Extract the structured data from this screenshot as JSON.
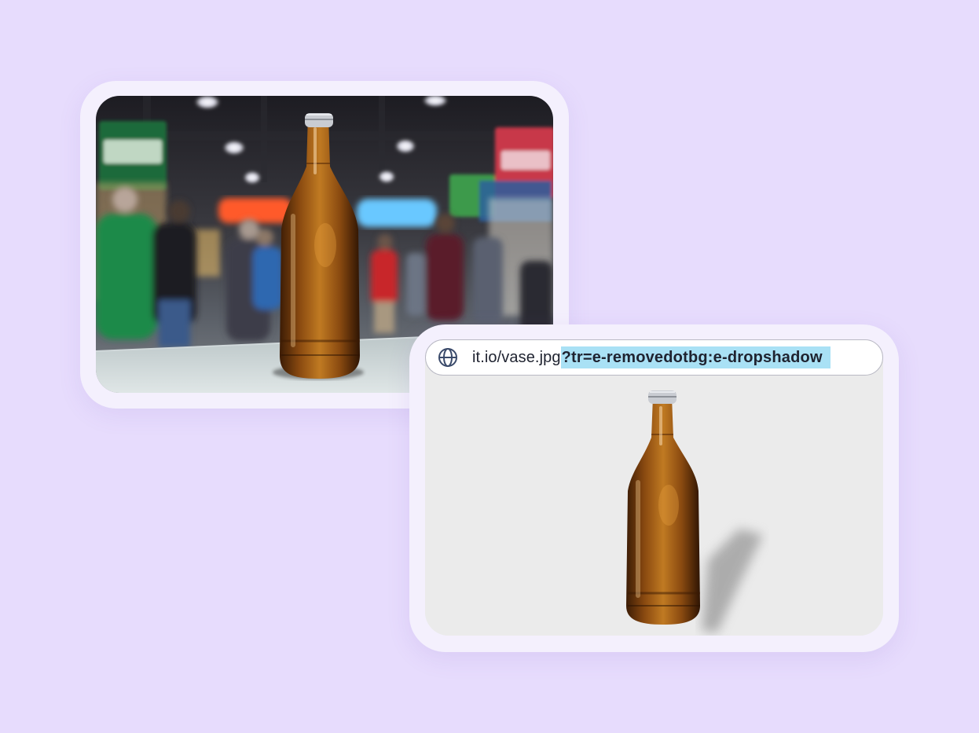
{
  "url_bar": {
    "icon": "globe-icon",
    "base": "it.io/vase.jpg",
    "query": "?tr=e-removedotbg:e-dropshadow"
  },
  "original_image": {
    "subject": "amber glass bottle on table in busy market hall"
  },
  "result_image": {
    "subject": "amber glass bottle on plain grey background with drop shadow"
  },
  "colors": {
    "page_background": "#e7dcfd",
    "card_background": "#f4f0fd",
    "highlight": "#a9e1f5",
    "result_background": "#ebebeb",
    "bottle_amber": "#8a4a10"
  }
}
